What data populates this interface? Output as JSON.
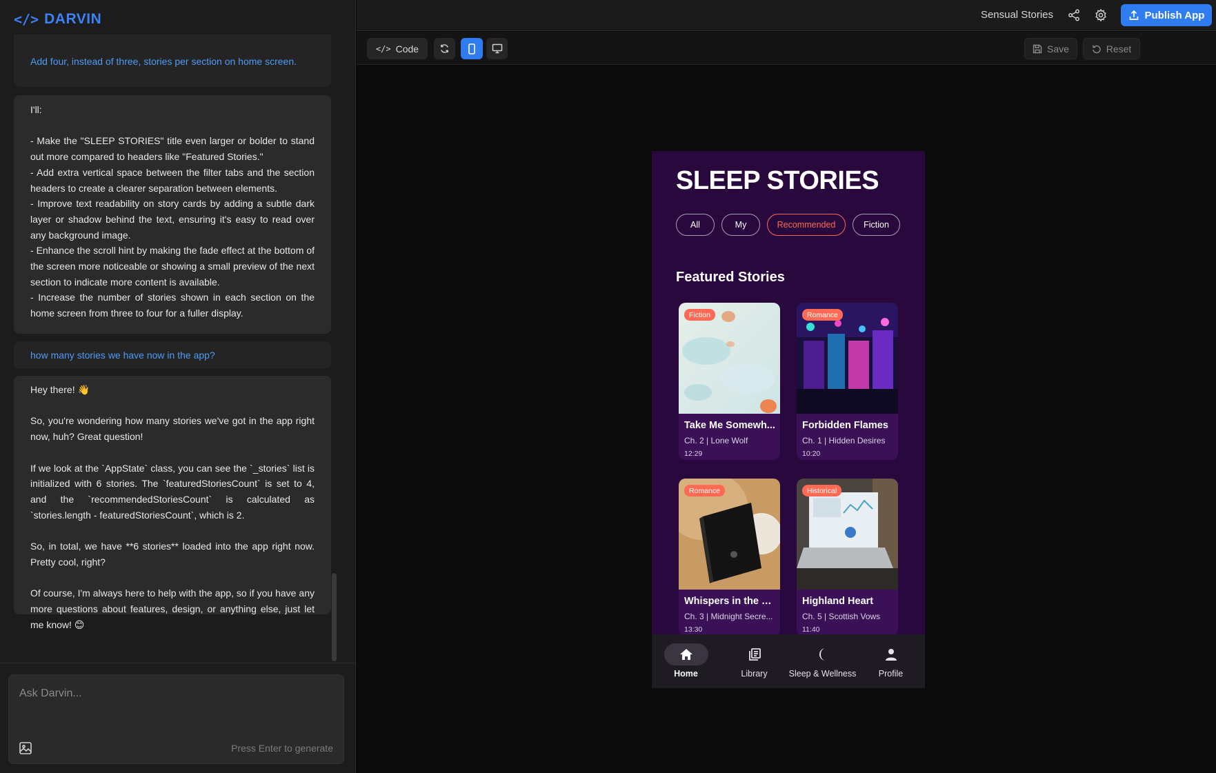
{
  "brand": {
    "logo": "</>",
    "name": "DARVIN"
  },
  "chat": [
    {
      "role": "user",
      "text": "Add four, instead of three, stories per section on home screen."
    },
    {
      "role": "ai",
      "text": "I'll:\n\n- Make the \"SLEEP STORIES\" title even larger or bolder to stand out more compared to headers like \"Featured Stories.\"\n- Add extra vertical space between the filter tabs and the section headers to create a clearer separation between elements.\n- Improve text readability on story cards by adding a subtle dark layer or shadow behind the text, ensuring it's easy to read over any background image.\n- Enhance the scroll hint by making the fade effect at the bottom of the screen more noticeable or showing a small preview of the next section to indicate more content is available.\n- Increase the number of stories shown in each section on the home screen from three to four for a fuller display."
    },
    {
      "role": "user",
      "text": "how many stories we have now in the app?"
    },
    {
      "role": "ai",
      "text": "Hey there! 👋\n\nSo, you're wondering how many stories we've got in the app right now, huh? Great question!\n\nIf we look at the `AppState` class, you can see the `_stories` list is initialized with 6 stories. The `featuredStoriesCount` is set to 4, and the `recommendedStoriesCount` is calculated as `stories.length - featuredStoriesCount`, which is 2.\n\nSo, in total, we have **6 stories** loaded into the app right now. Pretty cool, right?\n\nOf course, I'm always here to help with the app, so if you have any more questions about features, design, or anything else, just let me know! 😊"
    }
  ],
  "composer": {
    "placeholder": "Ask Darvin...",
    "hint": "Press Enter to generate",
    "image_icon": "image-icon"
  },
  "topbar": {
    "project_name": "Sensual Stories",
    "share_icon": "share-icon",
    "settings_icon": "gear-icon",
    "publish_label": "Publish App"
  },
  "toolbar": {
    "code_label": "Code",
    "save_label": "Save",
    "reset_label": "Reset",
    "refresh_icon": "refresh-icon",
    "mobile_icon": "phone-icon",
    "desktop_icon": "monitor-icon"
  },
  "app": {
    "title": "SLEEP STORIES",
    "filters": [
      "All",
      "My",
      "Recommended",
      "Fiction"
    ],
    "selected_filter": "Recommended",
    "section_title": "Featured Stories",
    "stories": [
      {
        "tag": "Fiction",
        "title": "Take Me Somewh...",
        "subtitle": "Ch. 2 | Lone Wolf",
        "time": "12:29"
      },
      {
        "tag": "Romance",
        "title": "Forbidden Flames",
        "subtitle": "Ch. 1 | Hidden Desires",
        "time": "10:20"
      },
      {
        "tag": "Romance",
        "title": "Whispers in the Da...",
        "subtitle": "Ch. 3 | Midnight Secre...",
        "time": "13:30"
      },
      {
        "tag": "Historical",
        "title": "Highland Heart",
        "subtitle": "Ch. 5 | Scottish Vows",
        "time": "11:40"
      }
    ],
    "nav": [
      {
        "label": "Home",
        "icon": "home-icon",
        "active": true
      },
      {
        "label": "Library",
        "icon": "library-icon",
        "active": false
      },
      {
        "label": "Sleep & Wellness",
        "icon": "moon-icon",
        "active": false
      },
      {
        "label": "Profile",
        "icon": "person-icon",
        "active": false
      }
    ]
  },
  "colors": {
    "accent": "#2f7bf0",
    "app_bg": "#28083d",
    "card_bg": "#3a1156",
    "tag": "#ff6a55",
    "user_text": "#4e9bf5"
  }
}
